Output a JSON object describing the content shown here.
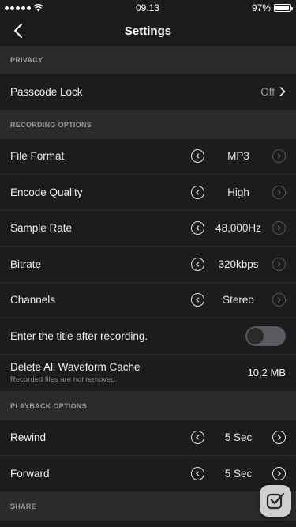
{
  "status_bar": {
    "time": "09.13",
    "battery": "97%",
    "battery_level": 0.97
  },
  "nav": {
    "title": "Settings"
  },
  "sections": {
    "privacy": {
      "header": "PRIVACY",
      "passcode": {
        "label": "Passcode Lock",
        "value": "Off"
      }
    },
    "recording": {
      "header": "RECORDING OPTIONS",
      "file_format": {
        "label": "File Format",
        "value": "MP3"
      },
      "encode_quality": {
        "label": "Encode Quality",
        "value": "High"
      },
      "sample_rate": {
        "label": "Sample Rate",
        "value": "48,000Hz"
      },
      "bitrate": {
        "label": "Bitrate",
        "value": "320kbps"
      },
      "channels": {
        "label": "Channels",
        "value": "Stereo"
      },
      "title_after": {
        "label": "Enter the title after recording.",
        "enabled": false
      },
      "cache": {
        "label": "Delete All Waveform Cache",
        "sublabel": "Recorded files are not removed.",
        "size": "10,2 MB"
      }
    },
    "playback": {
      "header": "PLAYBACK OPTIONS",
      "rewind": {
        "label": "Rewind",
        "value": "5 Sec"
      },
      "forward": {
        "label": "Forward",
        "value": "5 Sec"
      }
    },
    "share": {
      "header": "SHARE"
    }
  },
  "icons": {
    "back": "chevron-left-icon",
    "step_prev": "chevron-left-circle-icon",
    "step_next": "chevron-right-circle-icon",
    "disclosure": "chevron-right-icon",
    "badge": "check-square-icon"
  },
  "colors": {
    "background": "#1c1c1e",
    "section_bg": "#2b2b2d",
    "text": "#f0f0f0",
    "muted": "#9a9a9e"
  }
}
